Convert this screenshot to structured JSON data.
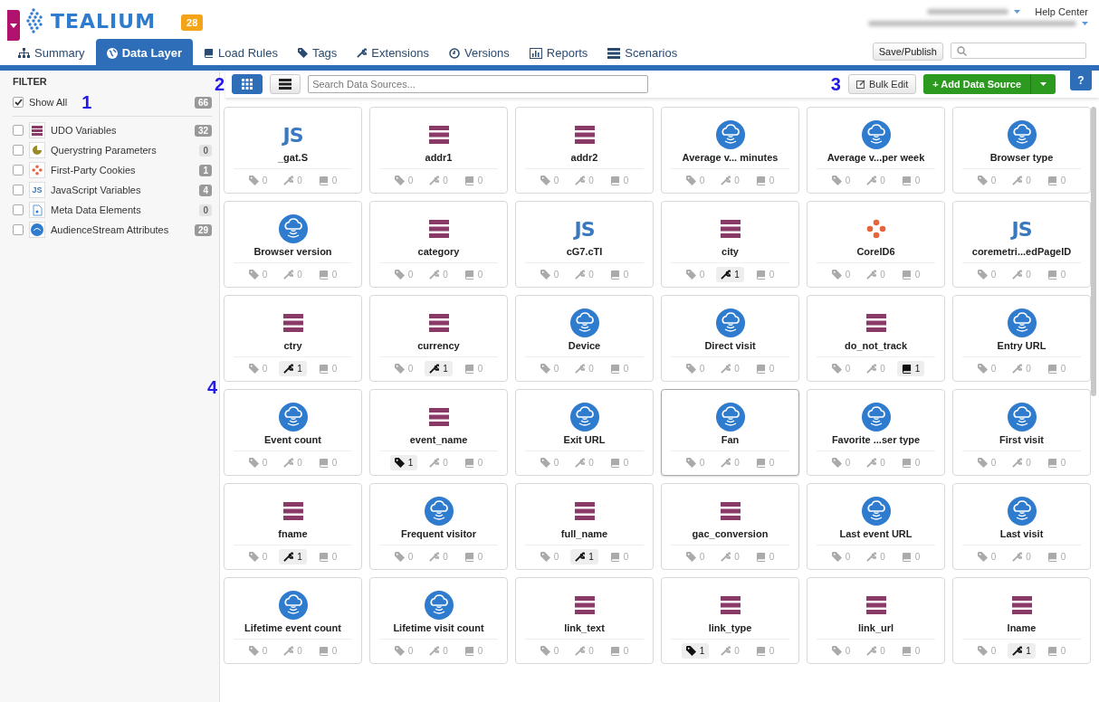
{
  "header": {
    "logo": "TEALIUM",
    "badge": "28",
    "help": "Help Center",
    "save_button": "Save/Publish"
  },
  "tabs": [
    {
      "label": "Summary",
      "selected": false
    },
    {
      "label": "Data Layer",
      "selected": true
    },
    {
      "label": "Load Rules",
      "selected": false
    },
    {
      "label": "Tags",
      "selected": false
    },
    {
      "label": "Extensions",
      "selected": false
    },
    {
      "label": "Versions",
      "selected": false
    },
    {
      "label": "Reports",
      "selected": false
    },
    {
      "label": "Scenarios",
      "selected": false
    }
  ],
  "filter": {
    "title": "FILTER",
    "show_all": {
      "label": "Show All",
      "checked": true,
      "count": "66"
    },
    "items": [
      {
        "kind": "udo",
        "label": "UDO Variables",
        "count": "32",
        "checked": false,
        "muted": false
      },
      {
        "kind": "query",
        "label": "Querystring Parameters",
        "count": "0",
        "checked": false,
        "muted": true
      },
      {
        "kind": "cookie",
        "label": "First-Party Cookies",
        "count": "1",
        "checked": false,
        "muted": false
      },
      {
        "kind": "js",
        "js_label": "JS",
        "label": "JavaScript Variables",
        "count": "4",
        "checked": false,
        "muted": false
      },
      {
        "kind": "meta",
        "label": "Meta Data Elements",
        "count": "0",
        "checked": false,
        "muted": true
      },
      {
        "kind": "audience",
        "label": "AudienceStream Attributes",
        "count": "29",
        "checked": false,
        "muted": false
      }
    ]
  },
  "toolbar": {
    "view_modes": [
      {
        "selected": true
      },
      {
        "selected": false
      }
    ],
    "search": {
      "placeholder": "Search Data Sources..."
    },
    "bulk_edit": "Bulk Edit",
    "add_button": "+ Add Data Source",
    "help": "?"
  },
  "annotations": [
    {
      "label": "1"
    },
    {
      "label": "2"
    },
    {
      "label": "3"
    },
    {
      "label": "4"
    }
  ],
  "cards": [
    {
      "kind": "js",
      "js_label": "JS",
      "name": "_gat.S",
      "counts": [
        "0",
        "0",
        "0"
      ],
      "highlight": [
        false,
        false,
        false
      ],
      "hovered": false
    },
    {
      "kind": "udo",
      "name": "addr1",
      "counts": [
        "0",
        "0",
        "0"
      ],
      "highlight": [
        false,
        false,
        false
      ],
      "hovered": false
    },
    {
      "kind": "udo",
      "name": "addr2",
      "counts": [
        "0",
        "0",
        "0"
      ],
      "highlight": [
        false,
        false,
        false
      ],
      "hovered": false
    },
    {
      "kind": "audience",
      "name": "Average v... minutes",
      "counts": [
        "0",
        "0",
        "0"
      ],
      "highlight": [
        false,
        false,
        false
      ],
      "hovered": false
    },
    {
      "kind": "audience",
      "name": "Average v...per week",
      "counts": [
        "0",
        "0",
        "0"
      ],
      "highlight": [
        false,
        false,
        false
      ],
      "hovered": false
    },
    {
      "kind": "audience",
      "name": "Browser type",
      "counts": [
        "0",
        "0",
        "0"
      ],
      "highlight": [
        false,
        false,
        false
      ],
      "hovered": false
    },
    {
      "kind": "audience",
      "name": "Browser version",
      "counts": [
        "0",
        "0",
        "0"
      ],
      "highlight": [
        false,
        false,
        false
      ],
      "hovered": false
    },
    {
      "kind": "udo",
      "name": "category",
      "counts": [
        "0",
        "0",
        "0"
      ],
      "highlight": [
        false,
        false,
        false
      ],
      "hovered": false
    },
    {
      "kind": "js",
      "js_label": "JS",
      "name": "cG7.cTI",
      "counts": [
        "0",
        "0",
        "0"
      ],
      "highlight": [
        false,
        false,
        false
      ],
      "hovered": false
    },
    {
      "kind": "udo",
      "name": "city",
      "counts": [
        "0",
        "1",
        "0"
      ],
      "highlight": [
        false,
        true,
        false
      ],
      "hovered": false
    },
    {
      "kind": "cookie",
      "name": "CoreID6",
      "counts": [
        "0",
        "0",
        "0"
      ],
      "highlight": [
        false,
        false,
        false
      ],
      "hovered": false
    },
    {
      "kind": "js",
      "js_label": "JS",
      "name": "coremetri...edPageID",
      "counts": [
        "0",
        "0",
        "0"
      ],
      "highlight": [
        false,
        false,
        false
      ],
      "hovered": false
    },
    {
      "kind": "udo",
      "name": "ctry",
      "counts": [
        "0",
        "1",
        "0"
      ],
      "highlight": [
        false,
        true,
        false
      ],
      "hovered": false
    },
    {
      "kind": "udo",
      "name": "currency",
      "counts": [
        "0",
        "1",
        "0"
      ],
      "highlight": [
        false,
        true,
        false
      ],
      "hovered": false
    },
    {
      "kind": "audience",
      "name": "Device",
      "counts": [
        "0",
        "0",
        "0"
      ],
      "highlight": [
        false,
        false,
        false
      ],
      "hovered": false
    },
    {
      "kind": "audience",
      "name": "Direct visit",
      "counts": [
        "0",
        "0",
        "0"
      ],
      "highlight": [
        false,
        false,
        false
      ],
      "hovered": false
    },
    {
      "kind": "udo",
      "name": "do_not_track",
      "counts": [
        "0",
        "0",
        "1"
      ],
      "highlight": [
        false,
        false,
        true
      ],
      "hovered": false
    },
    {
      "kind": "audience",
      "name": "Entry URL",
      "counts": [
        "0",
        "0",
        "0"
      ],
      "highlight": [
        false,
        false,
        false
      ],
      "hovered": false
    },
    {
      "kind": "audience",
      "name": "Event count",
      "counts": [
        "0",
        "0",
        "0"
      ],
      "highlight": [
        false,
        false,
        false
      ],
      "hovered": false
    },
    {
      "kind": "udo",
      "name": "event_name",
      "counts": [
        "1",
        "0",
        "0"
      ],
      "highlight": [
        true,
        false,
        false
      ],
      "hovered": false
    },
    {
      "kind": "audience",
      "name": "Exit URL",
      "counts": [
        "0",
        "0",
        "0"
      ],
      "highlight": [
        false,
        false,
        false
      ],
      "hovered": false
    },
    {
      "kind": "audience",
      "name": "Fan",
      "counts": [
        "0",
        "0",
        "0"
      ],
      "highlight": [
        false,
        false,
        false
      ],
      "hovered": true
    },
    {
      "kind": "audience",
      "name": "Favorite ...ser type",
      "counts": [
        "0",
        "0",
        "0"
      ],
      "highlight": [
        false,
        false,
        false
      ],
      "hovered": false
    },
    {
      "kind": "audience",
      "name": "First visit",
      "counts": [
        "0",
        "0",
        "0"
      ],
      "highlight": [
        false,
        false,
        false
      ],
      "hovered": false
    },
    {
      "kind": "udo",
      "name": "fname",
      "counts": [
        "0",
        "1",
        "0"
      ],
      "highlight": [
        false,
        true,
        false
      ],
      "hovered": false
    },
    {
      "kind": "audience",
      "name": "Frequent visitor",
      "counts": [
        "0",
        "0",
        "0"
      ],
      "highlight": [
        false,
        false,
        false
      ],
      "hovered": false
    },
    {
      "kind": "udo",
      "name": "full_name",
      "counts": [
        "0",
        "1",
        "0"
      ],
      "highlight": [
        false,
        true,
        false
      ],
      "hovered": false
    },
    {
      "kind": "udo",
      "name": "gac_conversion",
      "counts": [
        "0",
        "0",
        "0"
      ],
      "highlight": [
        false,
        false,
        false
      ],
      "hovered": false
    },
    {
      "kind": "audience",
      "name": "Last event URL",
      "counts": [
        "0",
        "0",
        "0"
      ],
      "highlight": [
        false,
        false,
        false
      ],
      "hovered": false
    },
    {
      "kind": "audience",
      "name": "Last visit",
      "counts": [
        "0",
        "0",
        "0"
      ],
      "highlight": [
        false,
        false,
        false
      ],
      "hovered": false
    },
    {
      "kind": "audience",
      "name": "Lifetime event count",
      "counts": [
        "0",
        "0",
        "0"
      ],
      "highlight": [
        false,
        false,
        false
      ],
      "hovered": false
    },
    {
      "kind": "audience",
      "name": "Lifetime visit count",
      "counts": [
        "0",
        "0",
        "0"
      ],
      "highlight": [
        false,
        false,
        false
      ],
      "hovered": false
    },
    {
      "kind": "udo",
      "name": "link_text",
      "counts": [
        "0",
        "0",
        "0"
      ],
      "highlight": [
        false,
        false,
        false
      ],
      "hovered": false
    },
    {
      "kind": "udo",
      "name": "link_type",
      "counts": [
        "1",
        "0",
        "0"
      ],
      "highlight": [
        true,
        false,
        false
      ],
      "hovered": false
    },
    {
      "kind": "udo",
      "name": "link_url",
      "counts": [
        "0",
        "0",
        "0"
      ],
      "highlight": [
        false,
        false,
        false
      ],
      "hovered": false
    },
    {
      "kind": "udo",
      "name": "lname",
      "counts": [
        "0",
        "1",
        "0"
      ],
      "highlight": [
        false,
        true,
        false
      ],
      "hovered": false
    }
  ]
}
